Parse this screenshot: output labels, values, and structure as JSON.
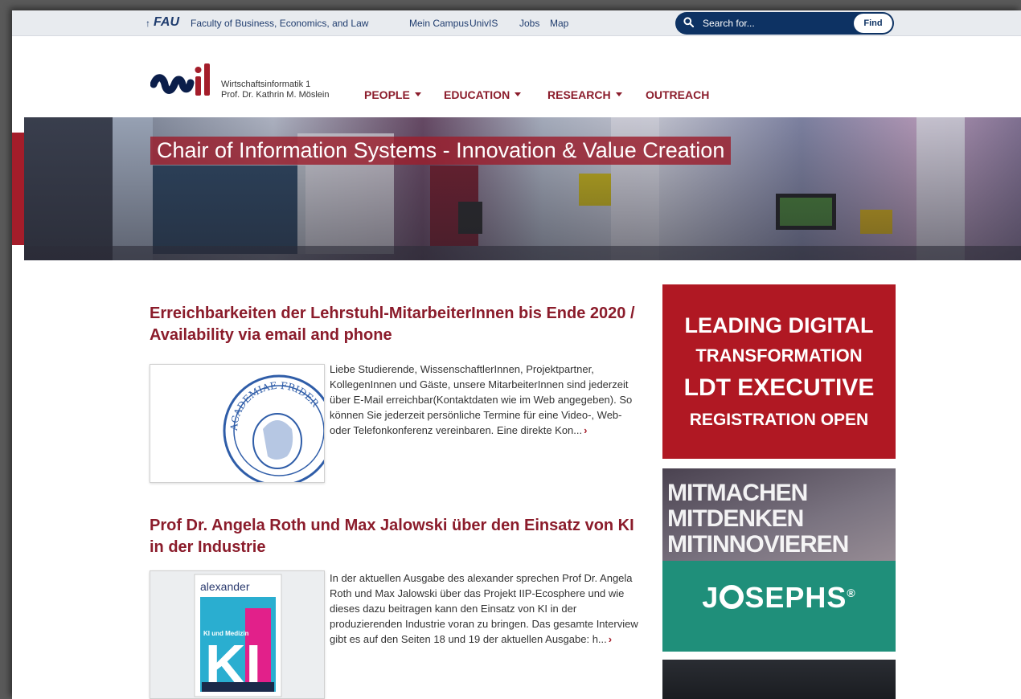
{
  "topbar": {
    "fau_arrow": "↑",
    "fau_logo": "FAU",
    "faculty": "Faculty of Business, Economics, and Law",
    "meta_links": [
      "Mein Campus",
      "UnivIS",
      "Jobs",
      "Map"
    ],
    "search_placeholder": "Search for...",
    "find_label": "Find"
  },
  "logo": {
    "line1": "Wirtschaftsinformatik 1",
    "line2": "Prof. Dr. Kathrin M. Möslein"
  },
  "nav": [
    {
      "label": "PEOPLE",
      "dropdown": true
    },
    {
      "label": "EDUCATION",
      "dropdown": true
    },
    {
      "label": "RESEARCH",
      "dropdown": true
    },
    {
      "label": "OUTREACH",
      "dropdown": false
    }
  ],
  "hero": {
    "title": "Chair of Information Systems - Innovation & Value Creation"
  },
  "posts": [
    {
      "title": "Erreichbarkeiten der Lehrstuhl-MitarbeiterInnen bis Ende 2020 / Availability via email and phone",
      "excerpt": "Liebe Studierende, WissenschaftlerInnen, Projektpartner, KollegenInnen und Gäste, unsere MitarbeiterInnen sind jederzeit über E-Mail erreichbar(Kontaktdaten wie im Web angegeben). So können Sie jederzeit persönliche Termine für eine Video-, Web- oder Telefonkonferenz vereinbaren. Eine direkte Kon...",
      "more": "›"
    },
    {
      "title": "Prof Dr. Angela Roth und Max Jalowski über den Einsatz von KI in der Industrie",
      "excerpt": "In der aktuellen Ausgabe des alexander sprechen Prof Dr. Angela Roth und Max Jalowski über das Projekt IIP-Ecosphere und wie dieses dazu beitragen kann den Einsatz von KI in der produzierenden Industrie voran zu bringen. Das gesamte Interview gibt es auf den Seiten 18 und 19 der aktuellen Ausgabe: h...",
      "more": "›"
    }
  ],
  "thumbs": {
    "seal_text": "ACADEMIAE FRIDER",
    "magazine_title": "alexander",
    "magazine_big": "KI",
    "magazine_sub": "KI und Medizin"
  },
  "banners": {
    "ldt": [
      "LEADING DIGITAL",
      "TRANSFORMATION",
      "LDT EXECUTIVE",
      "REGISTRATION OPEN"
    ],
    "josephs_lines": [
      "MITMACHEN",
      "MITDENKEN",
      "MITINNOVIEREN"
    ],
    "josephs_brand_1": "J",
    "josephs_brand_2": "SEPHS",
    "josephs_reg": "®"
  },
  "colors": {
    "brand_red": "#a41d2a",
    "navy": "#0d3263",
    "teal": "#1f8f7a"
  }
}
